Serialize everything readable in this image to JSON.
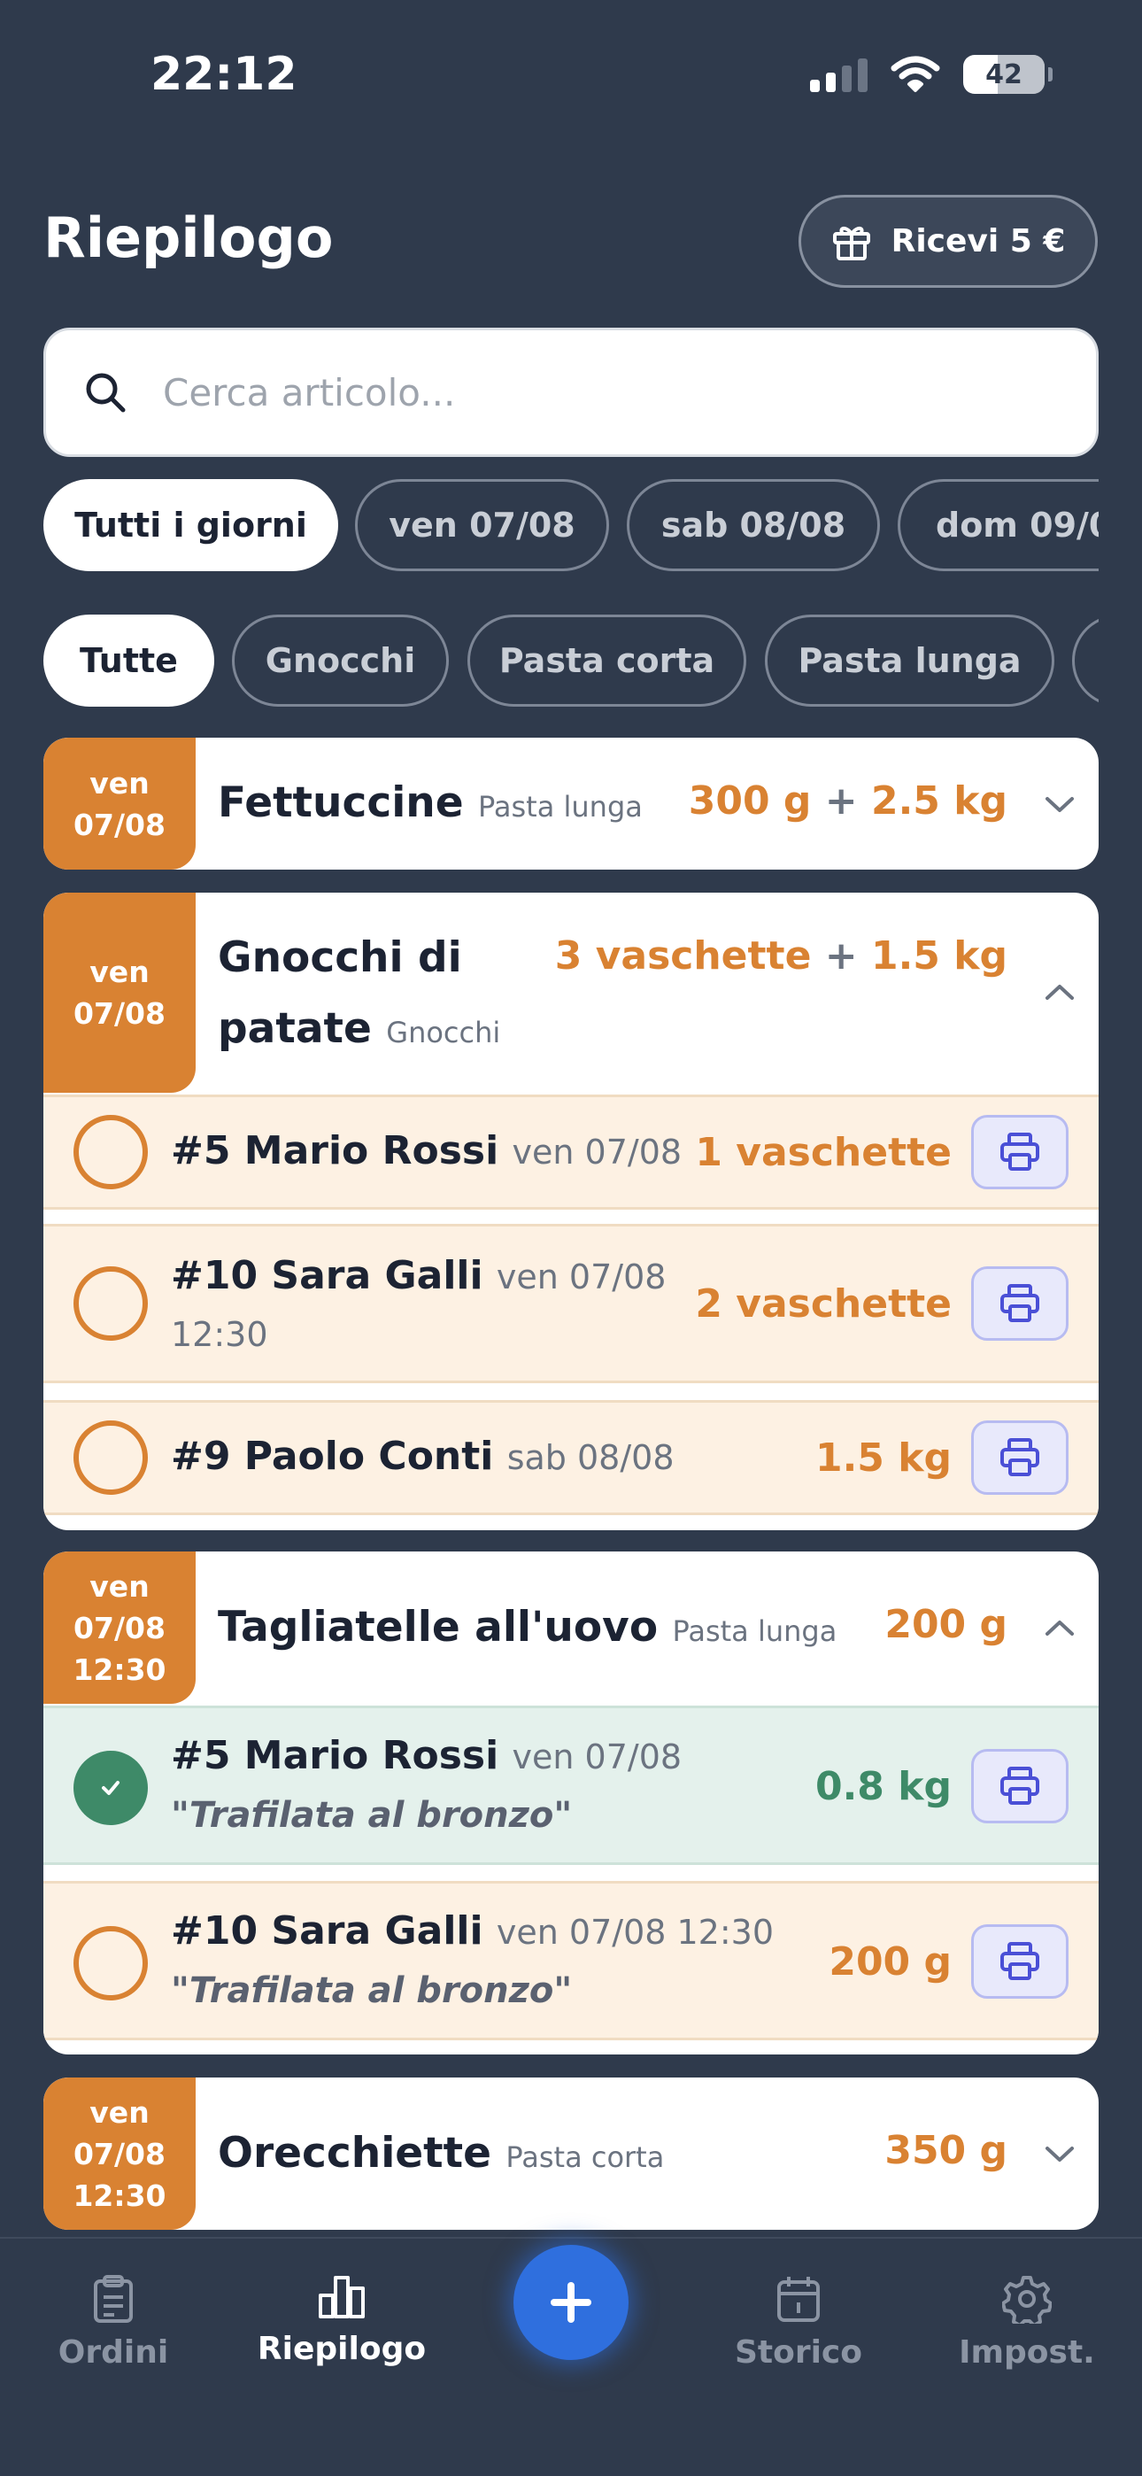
{
  "status": {
    "time": "22:12",
    "battery": "42"
  },
  "header": {
    "title": "Riepilogo",
    "gift_label": "Ricevi 5 €"
  },
  "search": {
    "placeholder": "Cerca articolo..."
  },
  "day_filters": [
    "Tutti i giorni",
    "ven 07/08",
    "sab 08/08",
    "dom 09/0"
  ],
  "category_filters": [
    "Tutte",
    "Gnocchi",
    "Pasta corta",
    "Pasta lunga",
    ""
  ],
  "cards": [
    {
      "date_line1": "ven",
      "date_line2": "07/08",
      "title": "Fettuccine",
      "category": "Pasta lunga",
      "qty_a": "300 g",
      "plus": "+",
      "qty_b": "2.5 kg"
    },
    {
      "date_line1": "ven",
      "date_line2": "07/08",
      "title_line1": "Gnocchi di",
      "title_line2": "patate",
      "category": "Gnocchi",
      "qty_a": "3 vaschette",
      "plus": "+",
      "qty_b": "1.5 kg",
      "orders": [
        {
          "customer": "#5 Mario Rossi",
          "date": "ven 07/08",
          "qty": "1 vaschette"
        },
        {
          "customer": "#10 Sara Galli",
          "date": "ven 07/08",
          "time": "12:30",
          "qty": "2 vaschette"
        },
        {
          "customer": "#9 Paolo Conti",
          "date": "sab 08/08",
          "qty": "1.5 kg"
        }
      ]
    },
    {
      "date_line1": "ven",
      "date_line2": "07/08",
      "date_line3": "12:30",
      "title": "Tagliatelle all'uovo",
      "category": "Pasta lunga",
      "qty_a": "200 g",
      "orders": [
        {
          "customer": "#5 Mario Rossi",
          "date": "ven 07/08",
          "note": "\"Trafilata al bronzo\"",
          "qty": "0.8 kg",
          "done": true
        },
        {
          "customer": "#10 Sara Galli",
          "date": "ven 07/08 12:30",
          "note": "\"Trafilata al bronzo\"",
          "qty": "200 g"
        }
      ]
    },
    {
      "date_line1": "ven",
      "date_line2": "07/08",
      "date_line3": "12:30",
      "title": "Orecchiette",
      "category": "Pasta corta",
      "qty_a": "350 g"
    }
  ],
  "tabs": [
    {
      "label": "Ordini",
      "icon": "clipboard-icon"
    },
    {
      "label": "Riepilogo",
      "icon": "bar-chart-icon",
      "active": true
    },
    {
      "label": "Storico",
      "icon": "calendar-icon"
    },
    {
      "label": "Impost.",
      "icon": "gear-icon"
    }
  ],
  "colors": {
    "accent": "#d98232",
    "done": "#3e8a68",
    "fab": "#2f6fde",
    "background": "#2f3a4c"
  }
}
